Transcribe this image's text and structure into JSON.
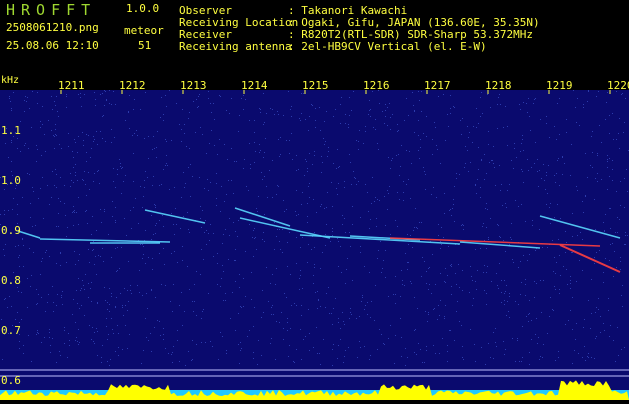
{
  "header": {
    "app_title": "HROFFT",
    "app_version": "1.0.0",
    "file_name": "2508061210.png",
    "timestamp": "25.08.06 12:10",
    "meteor_label": "meteor",
    "meteor_count": "51",
    "meta": [
      {
        "key": "Observer",
        "value": ": Takanori Kawachi"
      },
      {
        "key": "Receiving Location",
        "value": ": Ogaki, Gifu, JAPAN (136.60E, 35.35N)"
      },
      {
        "key": "Receiver",
        "value": ": R820T2(RTL-SDR) SDR-Sharp 53.372MHz"
      },
      {
        "key": "Receiving antenna",
        "value": ": 2el-HB9CV Vertical (el. E-W)"
      }
    ]
  },
  "axis": {
    "unit": "kHz",
    "x_ticks": [
      "1211",
      "1212",
      "1213",
      "1214",
      "1215",
      "1216",
      "1217",
      "1218",
      "1219",
      "1220"
    ],
    "y_ticks": [
      "1.1",
      "1.0",
      "0.9",
      "0.8",
      "0.7",
      "0.6"
    ]
  },
  "colors": {
    "background": "#0a0a6e",
    "label": "#ffff40",
    "title": "#9fd830",
    "trace": "#5ad8ff",
    "strong": "#ff4040"
  }
}
